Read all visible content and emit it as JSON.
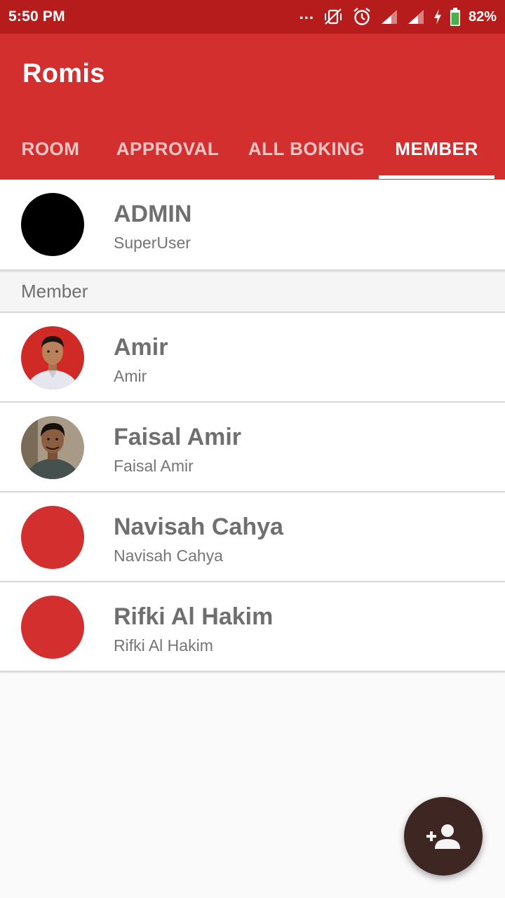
{
  "status_bar": {
    "time": "5:50 PM",
    "overflow_dots": "...",
    "battery_percent": "82%",
    "icons": [
      "vibrate-off-icon",
      "alarm-icon",
      "signal-icon",
      "signal-icon",
      "charging-icon",
      "battery-icon"
    ]
  },
  "app_bar": {
    "title": "Romis",
    "color": "#d32f2f",
    "tabs": [
      {
        "label": "ROOM",
        "active": false
      },
      {
        "label": "APPROVAL",
        "active": false
      },
      {
        "label": "ALL BOKING",
        "active": false
      },
      {
        "label": "MEMBER",
        "active": true
      }
    ]
  },
  "admin": {
    "name": "ADMIN",
    "role": "SuperUser",
    "avatar_color": "#000000"
  },
  "section_header": "Member",
  "members": [
    {
      "name": "Amir",
      "username": "Amir",
      "avatar": "photo"
    },
    {
      "name": "Faisal Amir",
      "username": "Faisal Amir",
      "avatar": "photo"
    },
    {
      "name": "Navisah Cahya",
      "username": "Navisah Cahya",
      "avatar_color": "#d32f2f"
    },
    {
      "name": "Rifki Al Hakim",
      "username": "Rifki Al Hakim",
      "avatar_color": "#d32f2f"
    }
  ],
  "fab": {
    "icon": "add-person-icon",
    "color": "#3e2723"
  }
}
